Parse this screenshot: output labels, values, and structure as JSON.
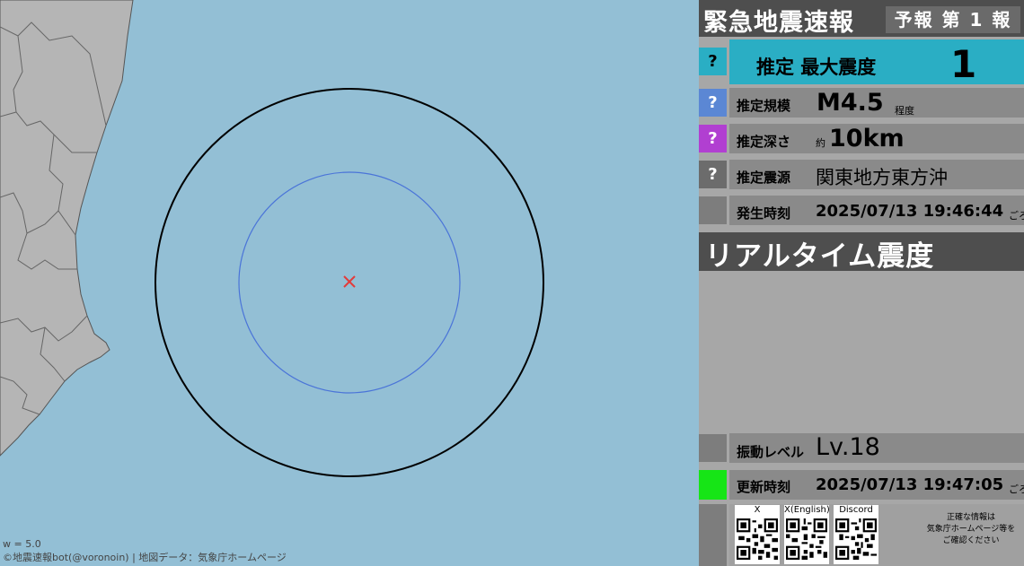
{
  "header": {
    "title": "緊急地震速報",
    "report_label": "予報 第 1 報"
  },
  "intensity": {
    "badge": "?",
    "label": "推定 最大震度",
    "value": "1"
  },
  "magnitude": {
    "badge": "?",
    "label": "推定規模",
    "value": "M4.5",
    "unit": "程度"
  },
  "depth": {
    "badge": "?",
    "label": "推定深さ",
    "prefix": "約",
    "value": "10km"
  },
  "epicenter": {
    "badge": "?",
    "label": "推定震源",
    "value": "関東地方東方沖"
  },
  "origin_time": {
    "label": "発生時刻",
    "value": "2025/07/13 19:46:44",
    "suffix": "ごろ"
  },
  "realtime": {
    "title": "リアルタイム震度"
  },
  "shake_level": {
    "label": "振動レベル",
    "value": "Lv.18"
  },
  "update_time": {
    "label": "更新時刻",
    "value": "2025/07/13 19:47:05",
    "suffix": "ごろ"
  },
  "qr_codes": [
    {
      "label": "X"
    },
    {
      "label": "X(English)"
    },
    {
      "label": "Discord"
    }
  ],
  "note": {
    "line1": "正確な情報は",
    "line2": "気象庁ホームページ等を",
    "line3": "ご確認ください"
  },
  "map": {
    "w_label": "w = 5.0",
    "credit": "©地震速報bot(@voronoin) | 地図データ：気象庁ホームページ",
    "colors": {
      "sea": "#93bfd5",
      "land": "#b5b5b5",
      "p_wave": "#000000",
      "s_wave": "#4a74d8",
      "epicenter": "#e23b3b"
    }
  }
}
